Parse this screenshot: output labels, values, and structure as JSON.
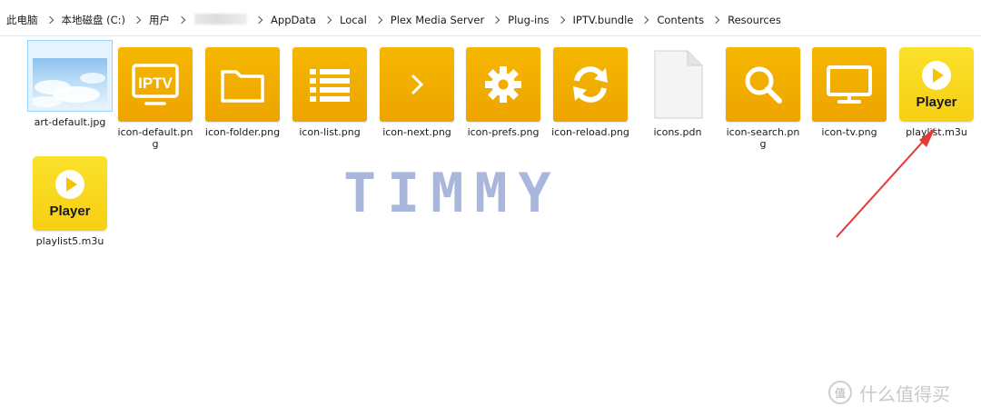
{
  "breadcrumb": {
    "items": [
      "此电脑",
      "本地磁盘 (C:)",
      "用户",
      "",
      "AppData",
      "Local",
      "Plex Media Server",
      "Plug-ins",
      "IPTV.bundle",
      "Contents",
      "Resources"
    ]
  },
  "files": [
    {
      "name": "art-default.jpg",
      "icon": "sky-image-thumbnail"
    },
    {
      "name": "icon-default.png",
      "icon": "iptv-icon"
    },
    {
      "name": "icon-folder.png",
      "icon": "folder-icon"
    },
    {
      "name": "icon-list.png",
      "icon": "list-icon"
    },
    {
      "name": "icon-next.png",
      "icon": "chevron-right-icon"
    },
    {
      "name": "icon-prefs.png",
      "icon": "gear-icon"
    },
    {
      "name": "icon-reload.png",
      "icon": "reload-icon"
    },
    {
      "name": "icons.pdn",
      "icon": "document-icon"
    },
    {
      "name": "icon-search.png",
      "icon": "search-icon"
    },
    {
      "name": "icon-tv.png",
      "icon": "tv-icon"
    },
    {
      "name": "playlist.m3u",
      "icon": "player-icon",
      "overlay_text": "Player"
    },
    {
      "name": "playlist5.m3u",
      "icon": "player-icon",
      "overlay_text": "Player"
    }
  ],
  "overlay": {
    "watermark": "TIMMY",
    "brand_badge": "值",
    "brand_text": "什么值得买"
  },
  "colors": {
    "tile": "#f5b700",
    "player_tile": "#fbe12a",
    "arrow": "#e53935",
    "watermark": "#a9b7dd"
  }
}
